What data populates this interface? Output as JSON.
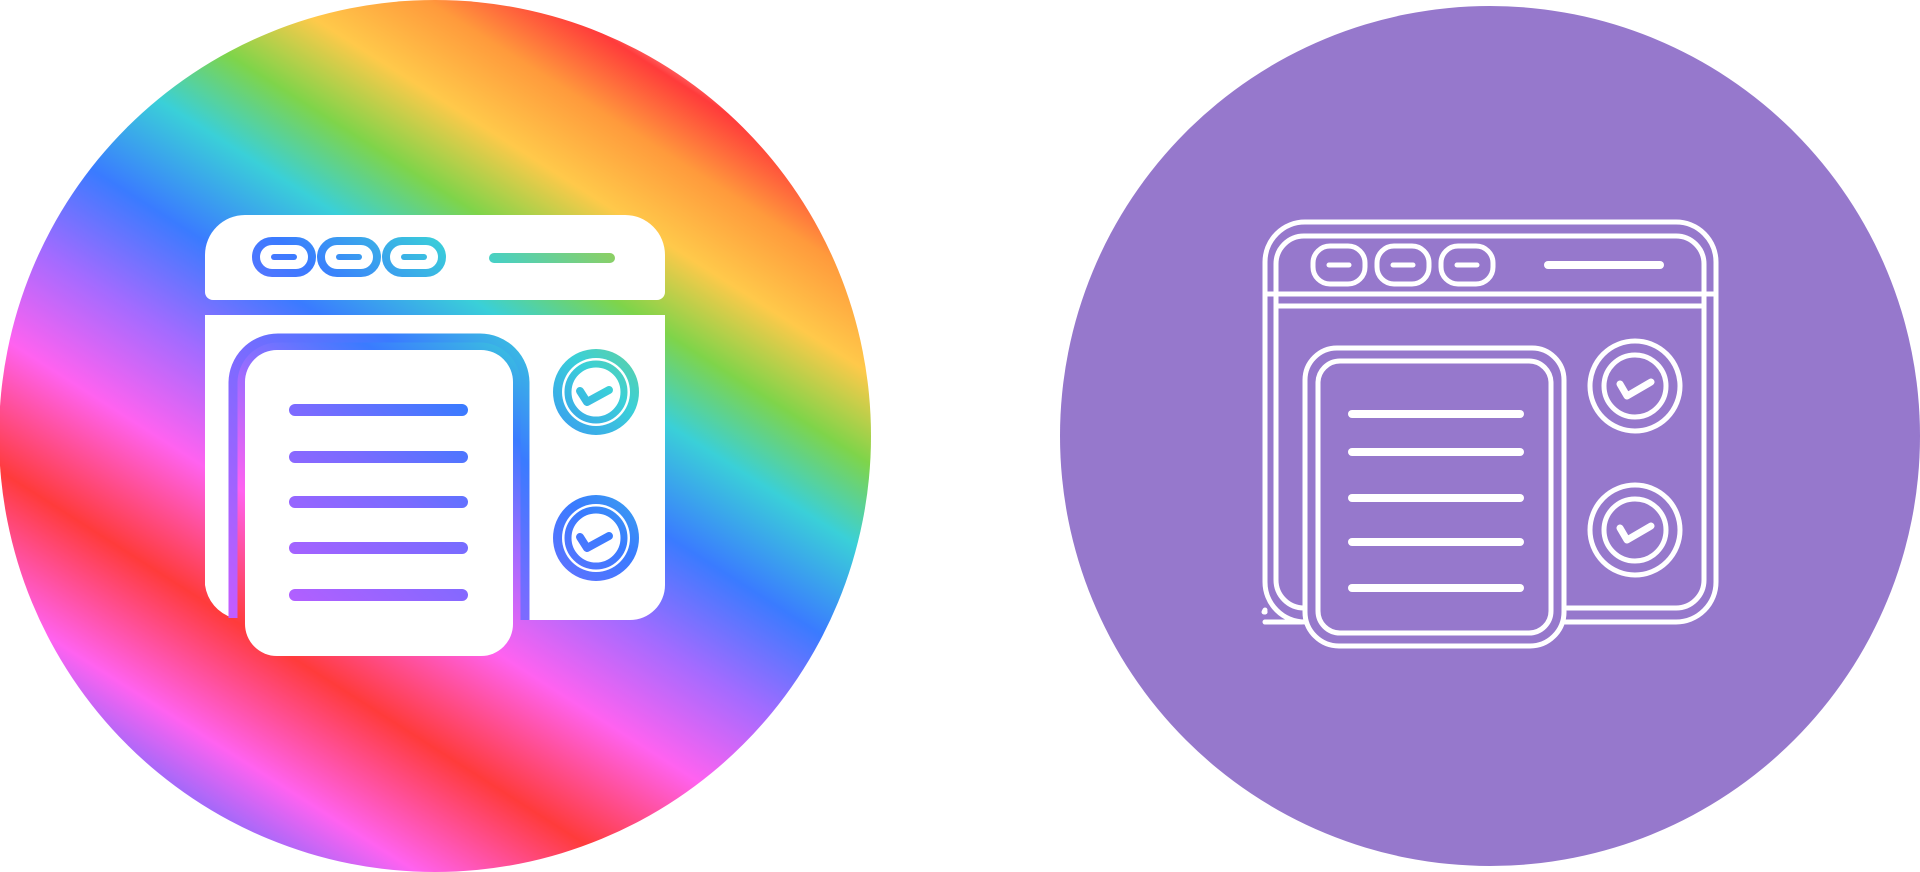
{
  "icons": [
    {
      "name": "checklist-window-icon",
      "style": "gradient-filled",
      "background": "rainbow-gradient",
      "palette": [
        "#ff3b3b",
        "#ff9a3c",
        "#ffd24a",
        "#7fd44a",
        "#3ad0d8",
        "#3a7bff",
        "#a36bff",
        "#ff62f0"
      ],
      "glyph_color": "#ffffff"
    },
    {
      "name": "checklist-window-icon",
      "style": "line",
      "background": "#9678cc",
      "glyph_color": "#ffffff"
    }
  ]
}
